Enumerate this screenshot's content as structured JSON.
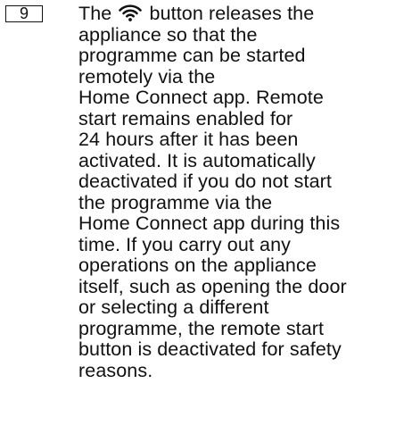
{
  "item": {
    "number": "9",
    "lines": [
      {
        "before_icon": "The",
        "icon": "wifi-icon",
        "after_icon": "button releases the"
      },
      {
        "text": "appliance so that the"
      },
      {
        "text": "programme can be started"
      },
      {
        "text": "remotely via the"
      },
      {
        "text": "Home Connect app. Remote"
      },
      {
        "text": "start remains enabled for"
      },
      {
        "text": "24 hours after it has been"
      },
      {
        "text": "activated. It is automatically"
      },
      {
        "text": "deactivated if you do not start"
      },
      {
        "text": "the programme via the"
      },
      {
        "text": "Home Connect app during this"
      },
      {
        "text": "time. If you carry out any"
      },
      {
        "text": "operations on the appliance"
      },
      {
        "text": "itself, such as opening the door"
      },
      {
        "text": "or selecting a different"
      },
      {
        "text": "programme, the remote start"
      },
      {
        "text": "button is deactivated for safety"
      },
      {
        "text": "reasons."
      }
    ]
  }
}
